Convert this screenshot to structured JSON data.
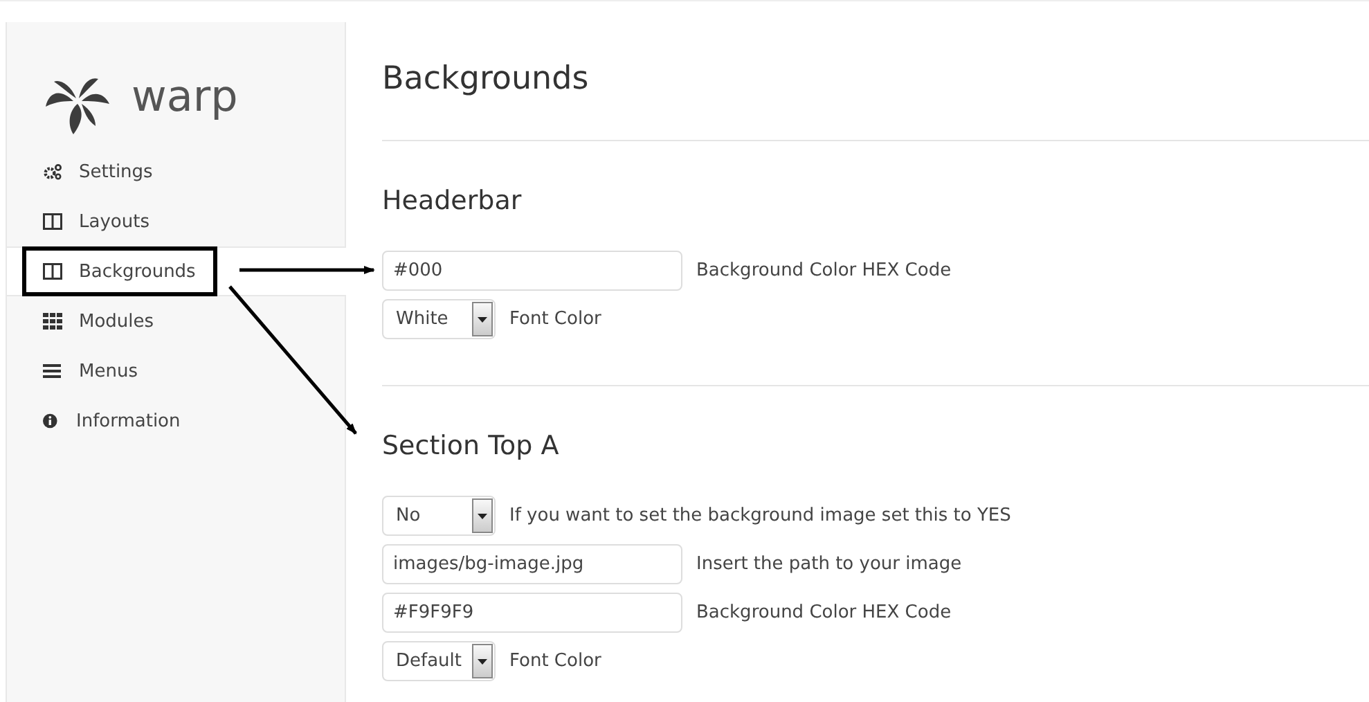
{
  "sidebar": {
    "logo": "warp",
    "items": [
      {
        "label": "Settings",
        "kind": "gears",
        "selected": false,
        "highlighted": false
      },
      {
        "label": "Layouts",
        "kind": "columns",
        "selected": false,
        "highlighted": false
      },
      {
        "label": "Backgrounds",
        "kind": "columns",
        "selected": true,
        "highlighted": true
      },
      {
        "label": "Modules",
        "kind": "grid",
        "selected": false,
        "highlighted": false
      },
      {
        "label": "Menus",
        "kind": "bars",
        "selected": false,
        "highlighted": false
      },
      {
        "label": "Information",
        "kind": "info",
        "selected": false,
        "highlighted": false
      }
    ]
  },
  "page": {
    "title": "Backgrounds",
    "sections": [
      {
        "title": "Headerbar",
        "fields": [
          {
            "kind": "input",
            "value": "#000",
            "help": "Background Color HEX Code"
          },
          {
            "kind": "select",
            "value": "White",
            "help": "Font Color"
          }
        ]
      },
      {
        "title": "Section Top A",
        "fields": [
          {
            "kind": "select",
            "value": "No",
            "help": "If you want to set the background image set this to YES"
          },
          {
            "kind": "input",
            "value": "images/bg-image.jpg",
            "help": "Insert the path to your image"
          },
          {
            "kind": "input",
            "value": "#F9F9F9",
            "help": "Background Color HEX Code"
          },
          {
            "kind": "select",
            "value": "Default",
            "help": "Font Color"
          }
        ]
      }
    ]
  }
}
